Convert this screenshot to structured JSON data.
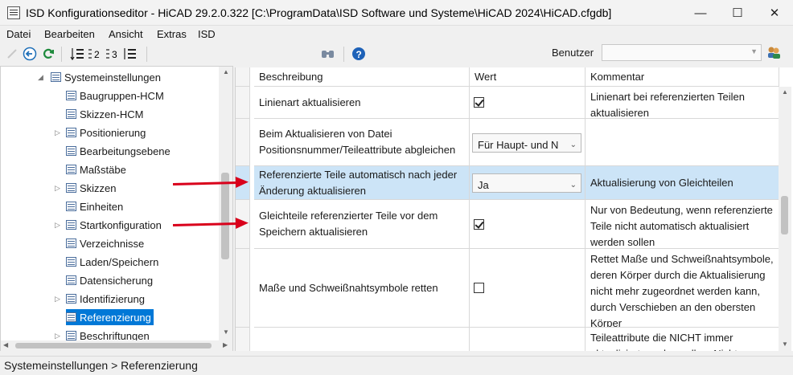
{
  "window": {
    "title": "ISD Konfigurationseditor  - HiCAD 29.2.0.322 [C:\\ProgramData\\ISD Software und Systeme\\HiCAD 2024\\HiCAD.cfgdb]",
    "minimize": "—",
    "maximize": "☐",
    "close": "✕"
  },
  "menu": [
    "Datei",
    "Bearbeiten",
    "Ansicht",
    "Extras",
    "ISD"
  ],
  "toolbar": {
    "benutzer_label": "Benutzer",
    "benutzer_value": "",
    "icons": [
      "pencil-icon",
      "back-icon",
      "refresh-icon",
      "sort-icon",
      "list-2-icon",
      "list-3-icon",
      "filter-list-icon",
      "find-icon",
      "help-icon",
      "users-icon"
    ]
  },
  "tree": {
    "root": "Systemeinstellungen",
    "items": [
      {
        "label": "Baugruppen-HCM",
        "expandable": false
      },
      {
        "label": "Skizzen-HCM",
        "expandable": false
      },
      {
        "label": "Positionierung",
        "expandable": true
      },
      {
        "label": "Bearbeitungsebene",
        "expandable": false
      },
      {
        "label": "Maßstäbe",
        "expandable": false
      },
      {
        "label": "Skizzen",
        "expandable": true
      },
      {
        "label": "Einheiten",
        "expandable": false
      },
      {
        "label": "Startkonfiguration",
        "expandable": true
      },
      {
        "label": "Verzeichnisse",
        "expandable": false
      },
      {
        "label": "Laden/Speichern",
        "expandable": false
      },
      {
        "label": "Datensicherung",
        "expandable": false
      },
      {
        "label": "Identifizierung",
        "expandable": true
      },
      {
        "label": "Referenzierung",
        "expandable": false,
        "selected": true
      },
      {
        "label": "Beschriftungen",
        "expandable": true
      }
    ]
  },
  "grid": {
    "columns": [
      "Beschreibung",
      "Wert",
      "Kommentar"
    ],
    "rows": [
      {
        "desc": "Linienart aktualisieren",
        "value_type": "checkbox",
        "checked": true,
        "comment": "Linienart bei referenzierten Teilen aktualisieren"
      },
      {
        "desc": "Beim Aktualisieren von Datei Positionsnummer/Teileattribute abgleichen",
        "value_type": "combo",
        "value": "Für Haupt- und N",
        "comment": ""
      },
      {
        "desc": "Referenzierte Teile automatisch nach jeder Änderung aktualisieren",
        "value_type": "combo",
        "value": "Ja",
        "comment": "Aktualisierung von Gleichteilen",
        "highlighted": true
      },
      {
        "desc": "Gleichteile referenzierter Teile vor dem Speichern aktualisieren",
        "value_type": "checkbox",
        "checked": true,
        "comment": "Nur von Bedeutung, wenn referenzierte Teile nicht automatisch aktualisiert werden sollen"
      },
      {
        "desc": "Maße und Schweißnahtsymbole retten",
        "value_type": "checkbox",
        "checked": false,
        "comment": "Rettet Maße und Schweißnahtsymbole, deren Körper durch die Aktualisierung nicht mehr zugeordnet werden kann, durch Verschieben an den obersten Körper"
      },
      {
        "desc": "",
        "value_type": "none",
        "comment": "Teileattribute die NICHT immer aktualisiert werden sollen. Nicht"
      }
    ]
  },
  "status": {
    "path": "Systemeinstellungen > Referenzierung"
  },
  "colors": {
    "selection": "#0078d7",
    "row_highlight": "#cce4f7",
    "arrow": "#d9001b"
  }
}
